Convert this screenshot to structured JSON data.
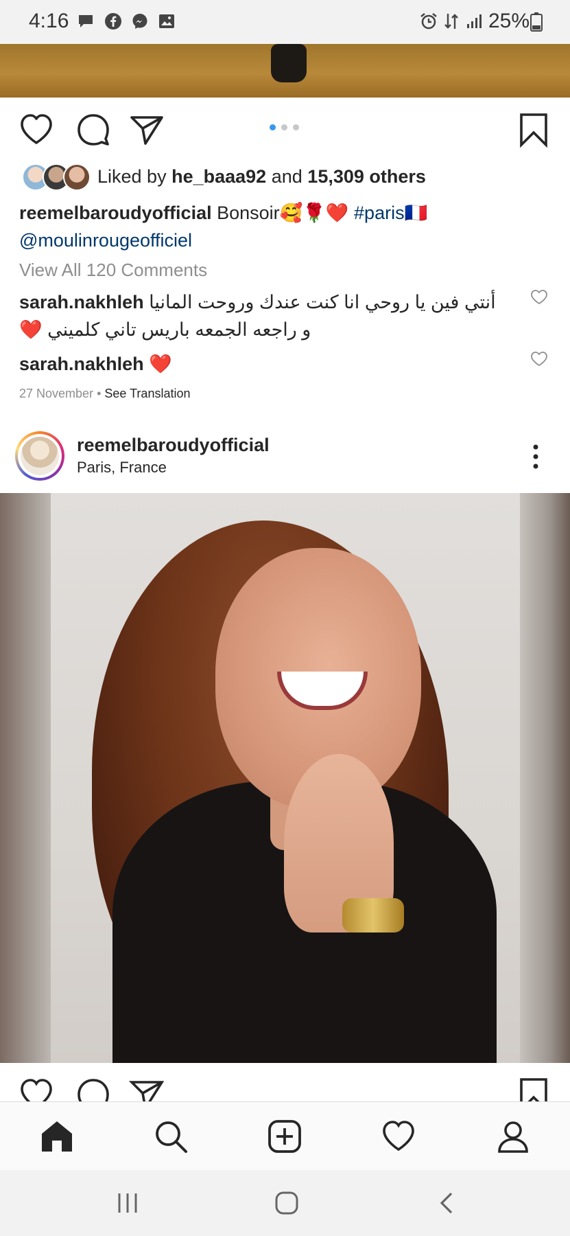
{
  "status_bar": {
    "time": "4:16",
    "battery": "25%",
    "left_icons": [
      "message-icon",
      "facebook-icon",
      "messenger-icon",
      "gallery-icon"
    ],
    "right_icons": [
      "alarm-icon",
      "data-arrows-icon",
      "signal-icon",
      "battery-icon"
    ]
  },
  "post1": {
    "likes_prefix": "Liked by",
    "likes_user": "he_baaa92",
    "likes_and": "and",
    "likes_others": "15,309 others",
    "caption_user": "reemelbaroudyofficial",
    "caption_text": "Bonsoir🥰🌹❤️",
    "caption_hashtag": "#paris🇫🇷",
    "caption_mention": "@moulinrougeofficiel",
    "view_comments": "View All 120 Comments",
    "comments": [
      {
        "user": "sarah.nakhleh",
        "text_line1": "أنتي فين يا روحي انا كنت عندك وروحت المانيا",
        "text_line2": "و راجعه الجمعه باريس تاني كلميني ❤️"
      },
      {
        "user": "sarah.nakhleh",
        "text_line1": "❤️",
        "text_line2": ""
      }
    ],
    "date": "27 November",
    "separator": "•",
    "see_translation": "See Translation",
    "carousel_dots": 3,
    "carousel_active": 0
  },
  "post2": {
    "username": "reemelbaroudyofficial",
    "location": "Paris, France"
  },
  "nav": {
    "items": [
      "home-icon",
      "search-icon",
      "new-post-icon",
      "activity-heart-icon",
      "profile-icon"
    ]
  },
  "colors": {
    "link": "#00376b",
    "carousel_active": "#3897f0",
    "heart_red": "#ed4956"
  }
}
